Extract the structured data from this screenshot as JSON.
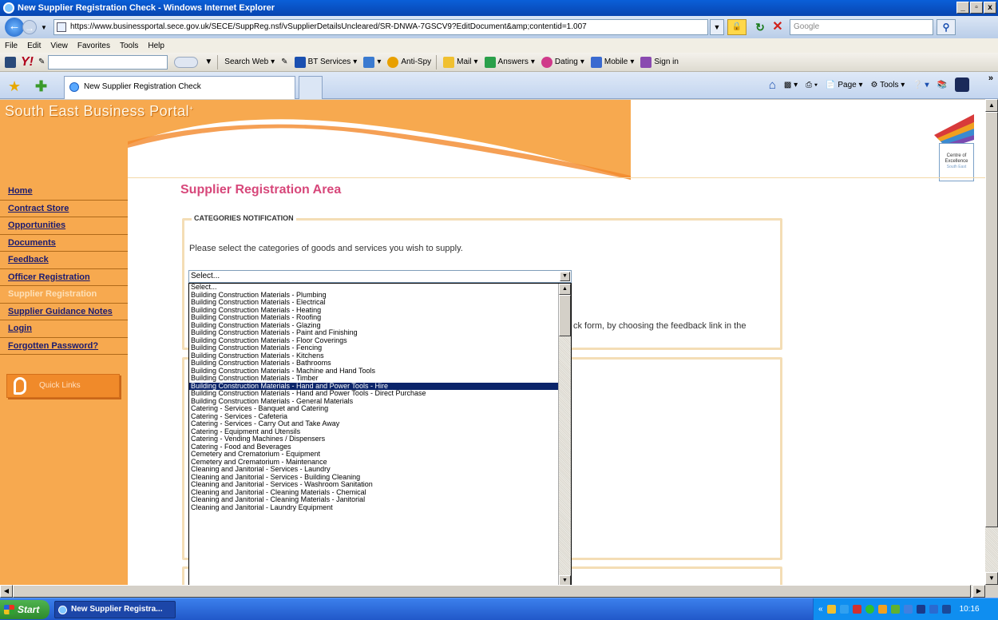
{
  "window": {
    "title": "New Supplier Registration Check - Windows Internet Explorer",
    "min": "_",
    "max": "▫",
    "close": "x"
  },
  "address": {
    "url": "https://www.businessportal.sece.gov.uk/SECE/SuppReg.nsf/vSupplierDetailsUncleared/SR-DNWA-7GSCV9?EditDocument&amp;contentid=1.007",
    "search_placeholder": "Google"
  },
  "menu": [
    "File",
    "Edit",
    "View",
    "Favorites",
    "Tools",
    "Help"
  ],
  "ytoolbar": {
    "search_web": "Search Web",
    "bt_services": "BT Services",
    "anti_spy": "Anti-Spy",
    "mail": "Mail",
    "answers": "Answers",
    "dating": "Dating",
    "mobile": "Mobile",
    "sign_in": "Sign in"
  },
  "tab": {
    "title": "New Supplier Registration Check"
  },
  "command_bar": {
    "page": "Page",
    "tools": "Tools"
  },
  "site": {
    "portal_title": "South East Business Portal",
    "portal_tm": "+",
    "coe_line1": "Centre of",
    "coe_line2": "Excellence",
    "coe_line3": "South East"
  },
  "sidebar": {
    "items": [
      {
        "label": "Home"
      },
      {
        "label": "Contract Store"
      },
      {
        "label": "Opportunities"
      },
      {
        "label": "Documents"
      },
      {
        "label": "Feedback"
      },
      {
        "label": "Officer Registration"
      },
      {
        "label": "Supplier Registration"
      },
      {
        "label": "Supplier Guidance Notes"
      },
      {
        "label": "Login"
      },
      {
        "label": "Forgotten Password?"
      }
    ],
    "quick_links": "Quick Links"
  },
  "main": {
    "title": "Supplier Registration Area",
    "legend": "CATEGORIES NOTIFICATION",
    "instructions": "Please select the categories of goods and services you wish to supply.",
    "feedback_fragment": "ck form, by choosing the feedback link in the"
  },
  "category_select": {
    "value": "Select...",
    "selected_option": "Building Construction Materials - Hand and Power Tools - Hire",
    "options": [
      "Select...",
      "Building Construction Materials - Plumbing",
      "Building Construction Materials - Electrical",
      "Building Construction Materials - Heating",
      "Building Construction Materials - Roofing",
      "Building Construction Materials - Glazing",
      "Building Construction Materials - Paint and Finishing",
      "Building Construction Materials - Floor Coverings",
      "Building Construction Materials - Fencing",
      "Building Construction Materials - Kitchens",
      "Building Construction Materials - Bathrooms",
      "Building Construction Materials - Machine and Hand Tools",
      "Building Construction Materials - Timber",
      "Building Construction Materials - Hand and Power Tools - Hire",
      "Building Construction Materials - Hand and Power Tools - Direct Purchase",
      "Building Construction Materials - General Materials",
      "Catering - Services - Banquet and Catering",
      "Catering - Services - Cafeteria",
      "Catering - Services - Carry Out and Take Away",
      "Catering - Equipment and Utensils",
      "Catering - Vending Machines / Dispensers",
      "Catering - Food and Beverages",
      "Cemetery and Crematorium - Equipment",
      "Cemetery and Crematorium - Maintenance",
      "Cleaning and Janitorial - Services - Laundry",
      "Cleaning and Janitorial - Services - Building Cleaning",
      "Cleaning and Janitorial - Services - Washroom Sanitation",
      "Cleaning and Janitorial - Cleaning Materials - Chemical",
      "Cleaning and Janitorial - Cleaning Materials - Janitorial",
      "Cleaning and Janitorial - Laundry Equipment"
    ]
  },
  "taskbar": {
    "start": "Start",
    "task": "New Supplier Registra...",
    "clock": "10:16"
  }
}
